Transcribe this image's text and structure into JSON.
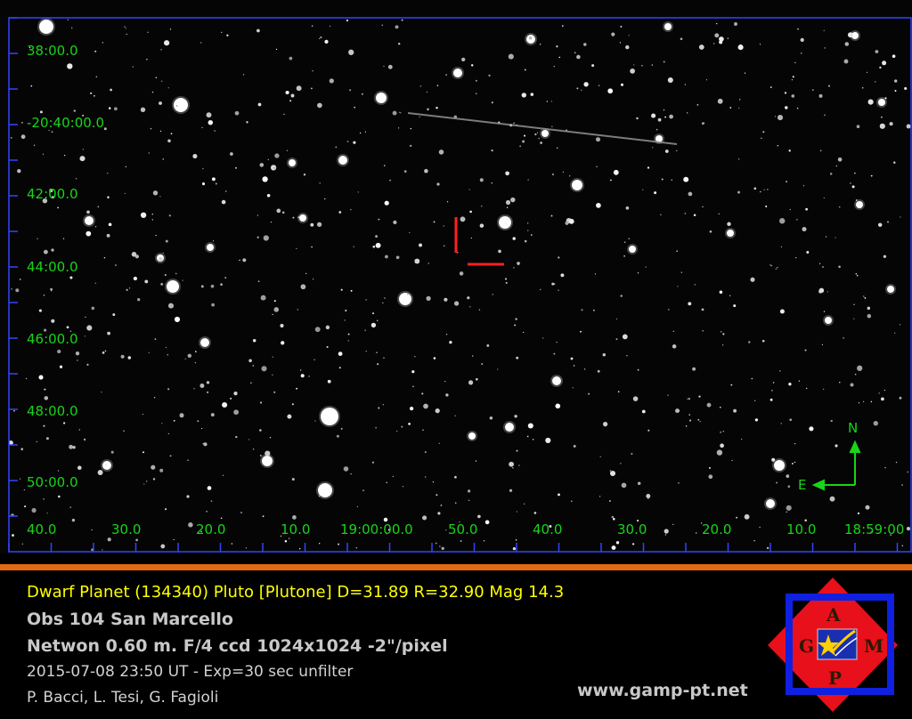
{
  "image": {
    "type": "astronomical CCD image",
    "target_marker_color": "#ff2020",
    "streak": "satellite trail"
  },
  "axes": {
    "dec_labels": [
      "38:00.0",
      "-20:40:00.0",
      "42:00.0",
      "44:00.0",
      "46:00.0",
      "48:00.0",
      "50:00.0"
    ],
    "ra_labels": [
      "40.0",
      "30.0",
      "20.0",
      "10.0",
      "19:00:00.0",
      "50.0",
      "40.0",
      "30.0",
      "20.0",
      "10.0",
      "18:59:00"
    ],
    "label_color": "#19d419"
  },
  "compass": {
    "north": "N",
    "east": "E"
  },
  "caption": {
    "title": "Dwarf Planet (134340) Pluto [Plutone] D=31.89 R=32.90 Mag 14.3",
    "observatory": "Obs 104 San Marcello",
    "instrument": "Netwon 0.60 m. F/4 ccd  1024x1024 -2\"/pixel",
    "datetime": "2015-07-08 23:50 UT -  Exp=30 sec unfilter",
    "authors": "P. Bacci, L. Tesi, G. Fagioli",
    "website": "www.gamp-pt.net"
  },
  "logo": {
    "letters": [
      "G",
      "A",
      "M",
      "P"
    ],
    "colors": {
      "diamond": "#e8101a",
      "frame": "#1020e0",
      "flag": "#1a2fb0",
      "star": "#ffd000"
    }
  }
}
